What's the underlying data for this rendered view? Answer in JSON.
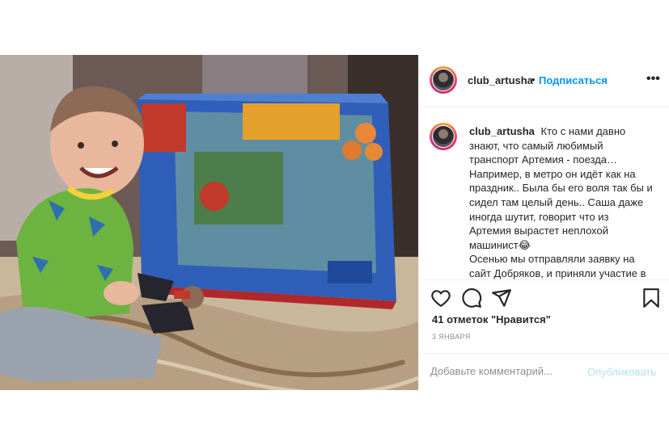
{
  "post": {
    "photo_icon": "post-photo",
    "header": {
      "username": "club_artusha",
      "separator": "•",
      "follow_label": "Подписаться",
      "more_icon": "more-options-icon",
      "more_glyph": "•••"
    },
    "caption": {
      "username": "club_artusha",
      "text": "Кто с нами давно знают, что самый любимый транспорт Артемия - поезда… Например, в метро он идёт как на праздник.. Была бы его воля так бы и сидел там целый день.. Саша даже иногда шутит, говорит что из Артемия вырастет неплохой машинист😂\nОсенью мы отправляли заявку на сайт Добряков, и приняли участие в"
    },
    "actions": {
      "like_icon": "heart-icon",
      "comment_icon": "comment-icon",
      "share_icon": "share-icon",
      "save_icon": "bookmark-icon"
    },
    "likes": "41 отметок \"Нравится\"",
    "date": "3 января",
    "comment": {
      "placeholder": "Добавьте комментарий...",
      "publish_label": "Опубликовать"
    }
  },
  "colors": {
    "accent": "#0095f6",
    "publish_disabled": "#b2dffc",
    "text": "#262626",
    "muted": "#8e8e8e",
    "border": "#efefef"
  }
}
